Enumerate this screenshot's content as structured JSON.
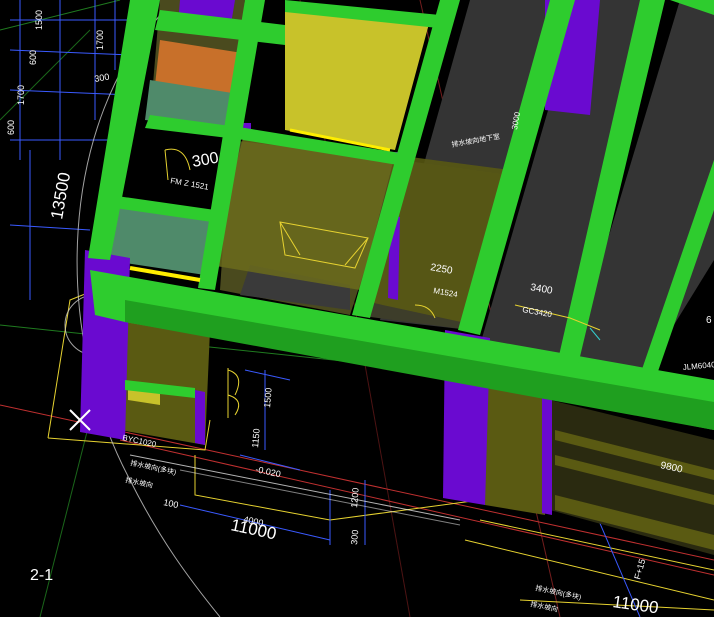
{
  "viewport": {
    "view_label": "2-1",
    "colors": {
      "background": "#000000",
      "beam": "#2ecc2e",
      "beam_dark": "#1f8f1f",
      "wall": "#5a5a12",
      "wall_light": "#6b6b1c",
      "column": "#6a0ad0",
      "slab": "#3a3a3a",
      "yellow_wall": "#c8c22a",
      "orange_wall": "#c8702a",
      "teal_wall": "#4f8a6a",
      "grid_red": "#c03030",
      "dim_blue": "#3a5aff",
      "dim_white": "#ffffff",
      "cad_yellow": "#e6d230"
    }
  },
  "dimensions": {
    "d_1500_top": "1500",
    "d_1700_top": "1700",
    "d_600": "600",
    "d_300_left": "300",
    "d_1700_mid": "1700",
    "d_600_b": "600",
    "d_13500": "13500",
    "d_300_room": "300",
    "d_1500_right": "1500",
    "d_1150": "1150",
    "d_neg020": "-0.020",
    "d_100": "100",
    "d_4000": "4000",
    "d_11000_a": "11000",
    "d_1200": "1200",
    "d_300_low": "300",
    "d_2250": "2250",
    "d_3400": "3400",
    "d_3000": "3000",
    "d_9800": "9800",
    "d_11000_b": "11000",
    "d_6": "6"
  },
  "labels": {
    "fm": "FM Z 1521",
    "m1524": "M1524",
    "gc3420": "GC3420",
    "jlm6040": "JLM6040",
    "byc1020": "BYC1020",
    "note_a1": "排水坡向(多块)",
    "note_a2": "排水坡向",
    "note_b1": "排水坡向(多块)",
    "note_b2": "排水坡向",
    "room_tag": "排水坡向地下室",
    "fl15": "F+15"
  }
}
